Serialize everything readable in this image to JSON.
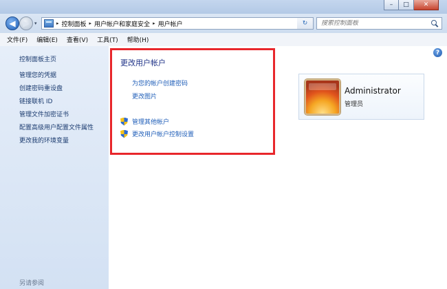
{
  "window": {
    "caption_buttons": {
      "minimize": "–",
      "maximize": "□",
      "close": "✕"
    }
  },
  "nav": {
    "back_icon": "back-arrow-icon",
    "forward_icon": "forward-arrow-icon",
    "back_glyph": "◀",
    "forward_glyph": "▶",
    "recent_glyph": "▾",
    "breadcrumb": [
      "控制面板",
      "用户帐户和家庭安全",
      "用户帐户"
    ],
    "separator": "▸",
    "dropdown_glyph": "▾",
    "refresh_glyph": "↻",
    "search_placeholder": "搜索控制面板"
  },
  "menubar": {
    "items": [
      {
        "label": "文件(F)"
      },
      {
        "label": "编辑(E)"
      },
      {
        "label": "查看(V)"
      },
      {
        "label": "工具(T)"
      },
      {
        "label": "帮助(H)"
      }
    ]
  },
  "sidebar": {
    "home": "控制面板主页",
    "links": [
      {
        "label": "管理您的凭据"
      },
      {
        "label": "创建密码重设盘"
      },
      {
        "label": "链接联机 ID"
      },
      {
        "label": "管理文件加密证书"
      },
      {
        "label": "配置高级用户配置文件属性"
      },
      {
        "label": "更改我的环境变量"
      }
    ],
    "see_also": "另请参阅"
  },
  "main": {
    "help_glyph": "?",
    "heading": "更改用户帐户",
    "links": [
      {
        "label": "为您的帐户创建密码"
      },
      {
        "label": "更改图片"
      }
    ],
    "shield_links": [
      {
        "label": "管理其他帐户"
      },
      {
        "label": "更改用户帐户控制设置"
      }
    ],
    "highlight_color": "#e8262b"
  },
  "account": {
    "name": "Administrator",
    "role": "管理员"
  },
  "colors": {
    "link": "#1f5eb8",
    "heading": "#1e3287",
    "sidebar_link": "#1b3b6f"
  }
}
